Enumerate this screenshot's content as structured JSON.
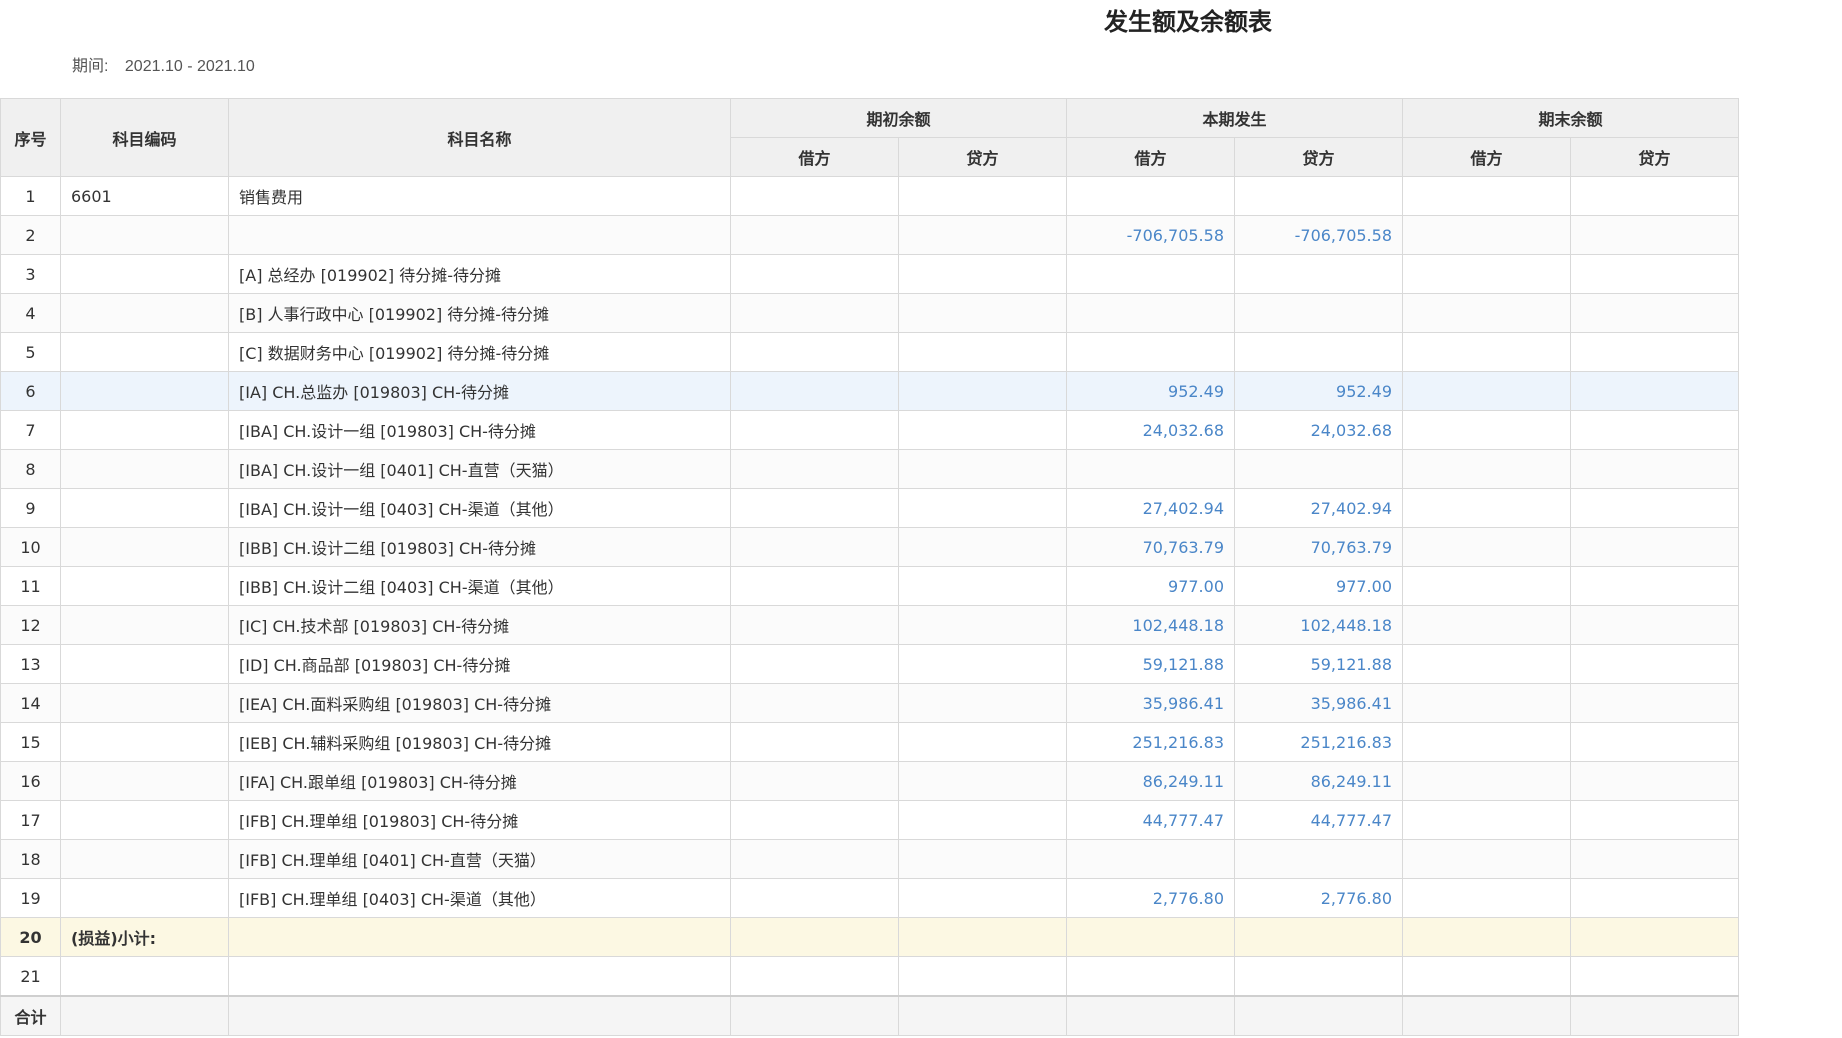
{
  "report": {
    "title": "发生额及余额表",
    "period_label": "期间:",
    "period_value": "2021.10 - 2021.10"
  },
  "columns": {
    "seq": "序号",
    "code": "科目编码",
    "name": "科目名称",
    "opening": "期初余额",
    "current": "本期发生",
    "closing": "期末余额",
    "debit": "借方",
    "credit": "贷方"
  },
  "rows": [
    {
      "seq": "1",
      "code": "6601",
      "name": "销售费用",
      "open_debit": "",
      "open_credit": "",
      "cur_debit": "",
      "cur_credit": "",
      "close_debit": "",
      "close_credit": ""
    },
    {
      "seq": "2",
      "code": "",
      "name": "",
      "open_debit": "",
      "open_credit": "",
      "cur_debit": "-706,705.58",
      "cur_credit": "-706,705.58",
      "close_debit": "",
      "close_credit": ""
    },
    {
      "seq": "3",
      "code": "",
      "name": "[A] 总经办 [019902] 待分摊-待分摊",
      "open_debit": "",
      "open_credit": "",
      "cur_debit": "",
      "cur_credit": "",
      "close_debit": "",
      "close_credit": ""
    },
    {
      "seq": "4",
      "code": "",
      "name": "[B] 人事行政中心 [019902] 待分摊-待分摊",
      "open_debit": "",
      "open_credit": "",
      "cur_debit": "",
      "cur_credit": "",
      "close_debit": "",
      "close_credit": ""
    },
    {
      "seq": "5",
      "code": "",
      "name": "[C] 数据财务中心 [019902] 待分摊-待分摊",
      "open_debit": "",
      "open_credit": "",
      "cur_debit": "",
      "cur_credit": "",
      "close_debit": "",
      "close_credit": ""
    },
    {
      "seq": "6",
      "code": "",
      "name": "[IA] CH.总监办 [019803] CH-待分摊",
      "open_debit": "",
      "open_credit": "",
      "cur_debit": "952.49",
      "cur_credit": "952.49",
      "close_debit": "",
      "close_credit": ""
    },
    {
      "seq": "7",
      "code": "",
      "name": "[IBA] CH.设计一组 [019803] CH-待分摊",
      "open_debit": "",
      "open_credit": "",
      "cur_debit": "24,032.68",
      "cur_credit": "24,032.68",
      "close_debit": "",
      "close_credit": ""
    },
    {
      "seq": "8",
      "code": "",
      "name": "[IBA] CH.设计一组 [0401] CH-直营（天猫）",
      "open_debit": "",
      "open_credit": "",
      "cur_debit": "",
      "cur_credit": "",
      "close_debit": "",
      "close_credit": ""
    },
    {
      "seq": "9",
      "code": "",
      "name": "[IBA] CH.设计一组 [0403] CH-渠道（其他）",
      "open_debit": "",
      "open_credit": "",
      "cur_debit": "27,402.94",
      "cur_credit": "27,402.94",
      "close_debit": "",
      "close_credit": ""
    },
    {
      "seq": "10",
      "code": "",
      "name": "[IBB] CH.设计二组 [019803] CH-待分摊",
      "open_debit": "",
      "open_credit": "",
      "cur_debit": "70,763.79",
      "cur_credit": "70,763.79",
      "close_debit": "",
      "close_credit": ""
    },
    {
      "seq": "11",
      "code": "",
      "name": "[IBB] CH.设计二组 [0403] CH-渠道（其他）",
      "open_debit": "",
      "open_credit": "",
      "cur_debit": "977.00",
      "cur_credit": "977.00",
      "close_debit": "",
      "close_credit": ""
    },
    {
      "seq": "12",
      "code": "",
      "name": "[IC] CH.技术部 [019803] CH-待分摊",
      "open_debit": "",
      "open_credit": "",
      "cur_debit": "102,448.18",
      "cur_credit": "102,448.18",
      "close_debit": "",
      "close_credit": ""
    },
    {
      "seq": "13",
      "code": "",
      "name": "[ID] CH.商品部 [019803] CH-待分摊",
      "open_debit": "",
      "open_credit": "",
      "cur_debit": "59,121.88",
      "cur_credit": "59,121.88",
      "close_debit": "",
      "close_credit": ""
    },
    {
      "seq": "14",
      "code": "",
      "name": "[IEA] CH.面料采购组 [019803] CH-待分摊",
      "open_debit": "",
      "open_credit": "",
      "cur_debit": "35,986.41",
      "cur_credit": "35,986.41",
      "close_debit": "",
      "close_credit": ""
    },
    {
      "seq": "15",
      "code": "",
      "name": "[IEB] CH.辅料采购组 [019803] CH-待分摊",
      "open_debit": "",
      "open_credit": "",
      "cur_debit": "251,216.83",
      "cur_credit": "251,216.83",
      "close_debit": "",
      "close_credit": ""
    },
    {
      "seq": "16",
      "code": "",
      "name": "[IFA] CH.跟单组 [019803] CH-待分摊",
      "open_debit": "",
      "open_credit": "",
      "cur_debit": "86,249.11",
      "cur_credit": "86,249.11",
      "close_debit": "",
      "close_credit": ""
    },
    {
      "seq": "17",
      "code": "",
      "name": "[IFB] CH.理单组 [019803] CH-待分摊",
      "open_debit": "",
      "open_credit": "",
      "cur_debit": "44,777.47",
      "cur_credit": "44,777.47",
      "close_debit": "",
      "close_credit": ""
    },
    {
      "seq": "18",
      "code": "",
      "name": "[IFB] CH.理单组 [0401] CH-直营（天猫）",
      "open_debit": "",
      "open_credit": "",
      "cur_debit": "",
      "cur_credit": "",
      "close_debit": "",
      "close_credit": ""
    },
    {
      "seq": "19",
      "code": "",
      "name": "[IFB] CH.理单组 [0403] CH-渠道（其他）",
      "open_debit": "",
      "open_credit": "",
      "cur_debit": "2,776.80",
      "cur_credit": "2,776.80",
      "close_debit": "",
      "close_credit": ""
    },
    {
      "seq": "20",
      "code": "(损益)小计:",
      "name": "",
      "open_debit": "",
      "open_credit": "",
      "cur_debit": "",
      "cur_credit": "",
      "close_debit": "",
      "close_credit": ""
    },
    {
      "seq": "21",
      "code": "",
      "name": "",
      "open_debit": "",
      "open_credit": "",
      "cur_debit": "",
      "cur_credit": "",
      "close_debit": "",
      "close_credit": ""
    }
  ],
  "total": {
    "seq": "合计"
  }
}
